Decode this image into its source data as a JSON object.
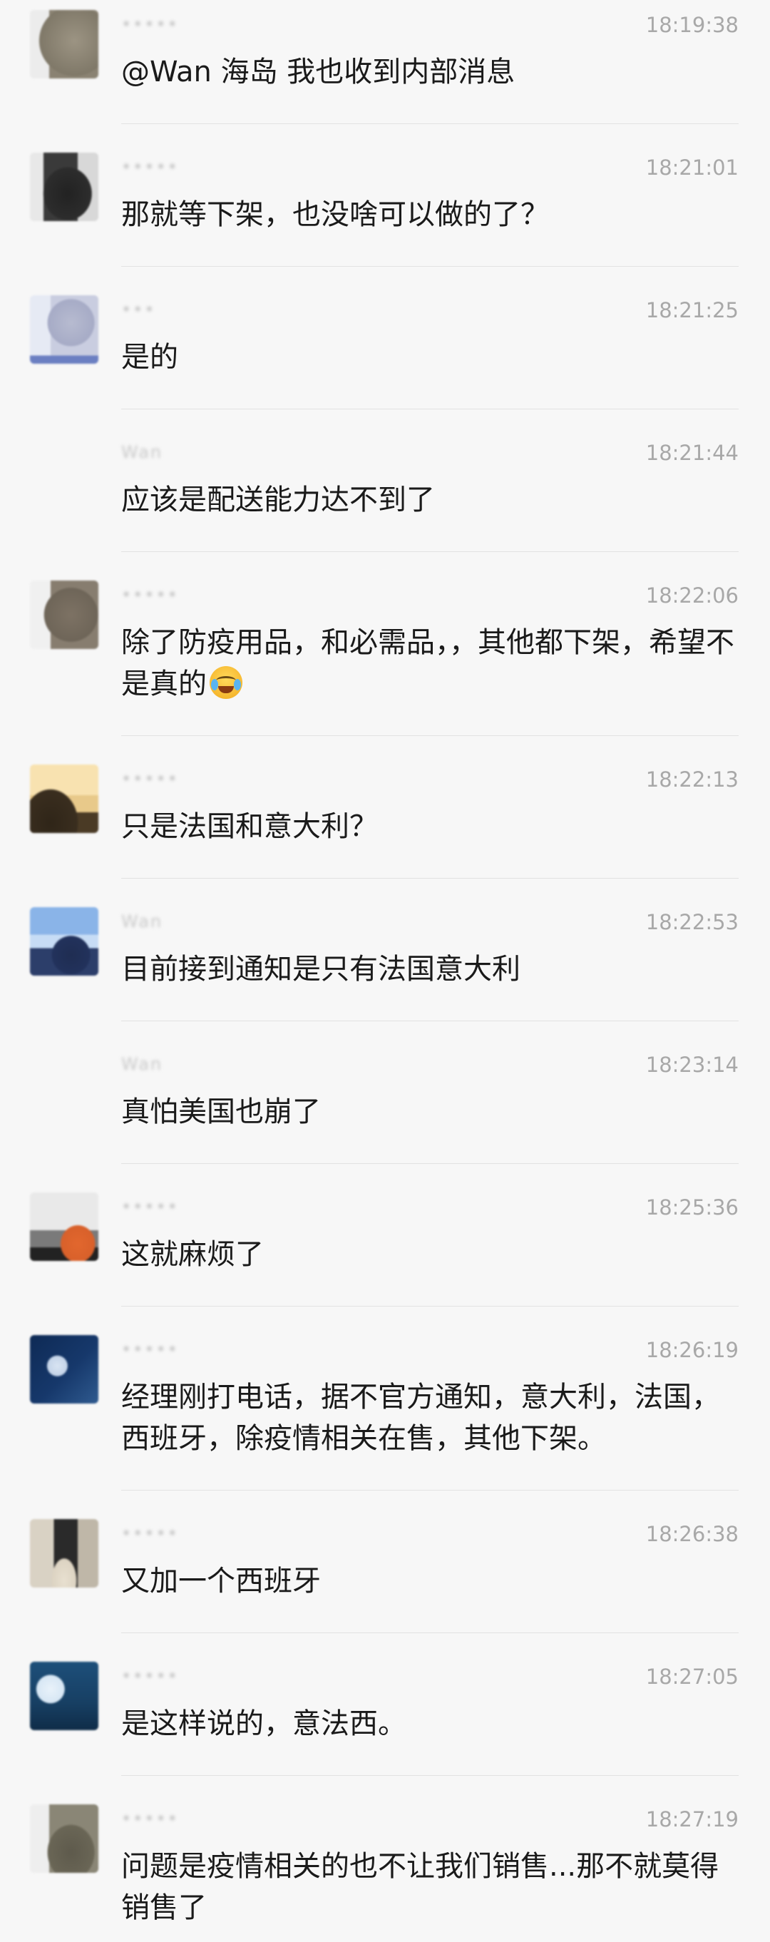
{
  "messages": [
    {
      "sender": "•••••",
      "time": "18:19:38",
      "text": "@Wan 海岛 我也收到内部消息",
      "avatar": "a1"
    },
    {
      "sender": "•••••",
      "time": "18:21:01",
      "text": "那就等下架，也没啥可以做的了？",
      "avatar": "a2"
    },
    {
      "sender": "•••",
      "time": "18:21:25",
      "text": "是的",
      "avatar": "a3"
    },
    {
      "sender": "Wan",
      "time": "18:21:44",
      "text": "应该是配送能力达不到了",
      "avatar": "none"
    },
    {
      "sender": "•••••",
      "time": "18:22:06",
      "text": "除了防疫用品，和必需品，，其他都下架，希望不是真的",
      "avatar": "a5",
      "emoji": "crying-laughing-emoji"
    },
    {
      "sender": "•••••",
      "time": "18:22:13",
      "text": "只是法国和意大利？",
      "avatar": "a6"
    },
    {
      "sender": "Wan",
      "time": "18:22:53",
      "text": "目前接到通知是只有法国意大利",
      "avatar": "a7"
    },
    {
      "sender": "Wan",
      "time": "18:23:14",
      "text": "真怕美国也崩了",
      "avatar": "none"
    },
    {
      "sender": "•••••",
      "time": "18:25:36",
      "text": "这就麻烦了",
      "avatar": "a9"
    },
    {
      "sender": "•••••",
      "time": "18:26:19",
      "text": "经理刚打电话，据不官方通知，意大利，法国，西班牙，除疫情相关在售，其他下架。",
      "avatar": "a10"
    },
    {
      "sender": "•••••",
      "time": "18:26:38",
      "text": "又加一个西班牙",
      "avatar": "a11"
    },
    {
      "sender": "•••••",
      "time": "18:27:05",
      "text": "是这样说的，意法西。",
      "avatar": "a12"
    },
    {
      "sender": "•••••",
      "time": "18:27:19",
      "text": "问题是疫情相关的也不让我们销售...那不就莫得销售了",
      "avatar": "a13"
    }
  ]
}
